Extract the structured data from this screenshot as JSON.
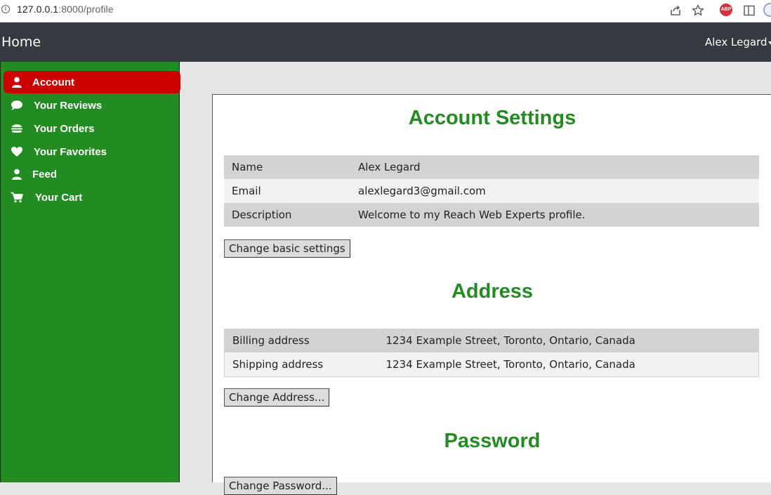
{
  "browser": {
    "url_host": "127.0.0.1",
    "url_path": ":8000/profile"
  },
  "navbar": {
    "home_label": "Home",
    "user_name": "Alex Legard"
  },
  "sidebar": {
    "items": [
      {
        "label": "Account",
        "icon": "user-icon",
        "active": true
      },
      {
        "label": "Your Reviews",
        "icon": "comment-icon",
        "active": false
      },
      {
        "label": "Your Orders",
        "icon": "burger-icon",
        "active": false
      },
      {
        "label": "Your Favorites",
        "icon": "heart-icon",
        "active": false
      },
      {
        "label": "Feed",
        "icon": "user-icon",
        "active": false
      },
      {
        "label": "Your Cart",
        "icon": "cart-icon",
        "active": false
      }
    ]
  },
  "account": {
    "title": "Account Settings",
    "rows": [
      {
        "label": "Name",
        "value": "Alex Legard"
      },
      {
        "label": "Email",
        "value": "alexlegard3@gmail.com"
      },
      {
        "label": "Description",
        "value": "Welcome to my Reach Web Experts profile."
      }
    ],
    "button_label": "Change basic settings"
  },
  "address": {
    "title": "Address",
    "rows": [
      {
        "label": "Billing address",
        "value": "1234 Example Street, Toronto, Ontario, Canada"
      },
      {
        "label": "Shipping address",
        "value": "1234 Example Street, Toronto, Ontario, Canada"
      }
    ],
    "button_label": "Change Address..."
  },
  "password": {
    "title": "Password",
    "button_label": "Change Password..."
  },
  "colors": {
    "sidebar_bg": "#228b22",
    "active_item": "#cc0000",
    "heading": "#228b22",
    "navbar_bg": "#343a40"
  }
}
